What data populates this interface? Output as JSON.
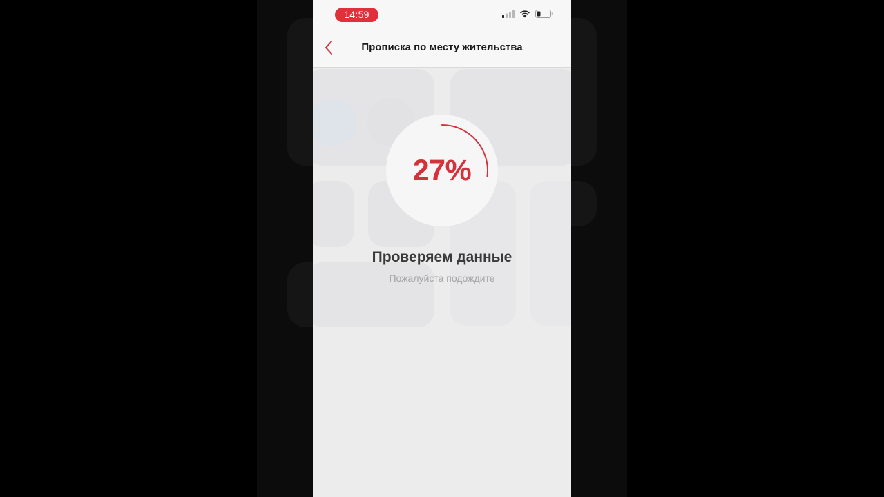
{
  "status_bar": {
    "time": "14:59",
    "icons": [
      "cellular-signal-icon",
      "wifi-icon",
      "battery-icon"
    ],
    "accent_color": "#e0303b"
  },
  "nav": {
    "back_icon": "chevron-left-icon",
    "title": "Прописка по месту жительства"
  },
  "progress": {
    "percent_label": "27%",
    "value": 0.27,
    "color": "#d5313d"
  },
  "status": {
    "title": "Проверяем данные",
    "subtitle": "Пожалуйста подождите"
  }
}
